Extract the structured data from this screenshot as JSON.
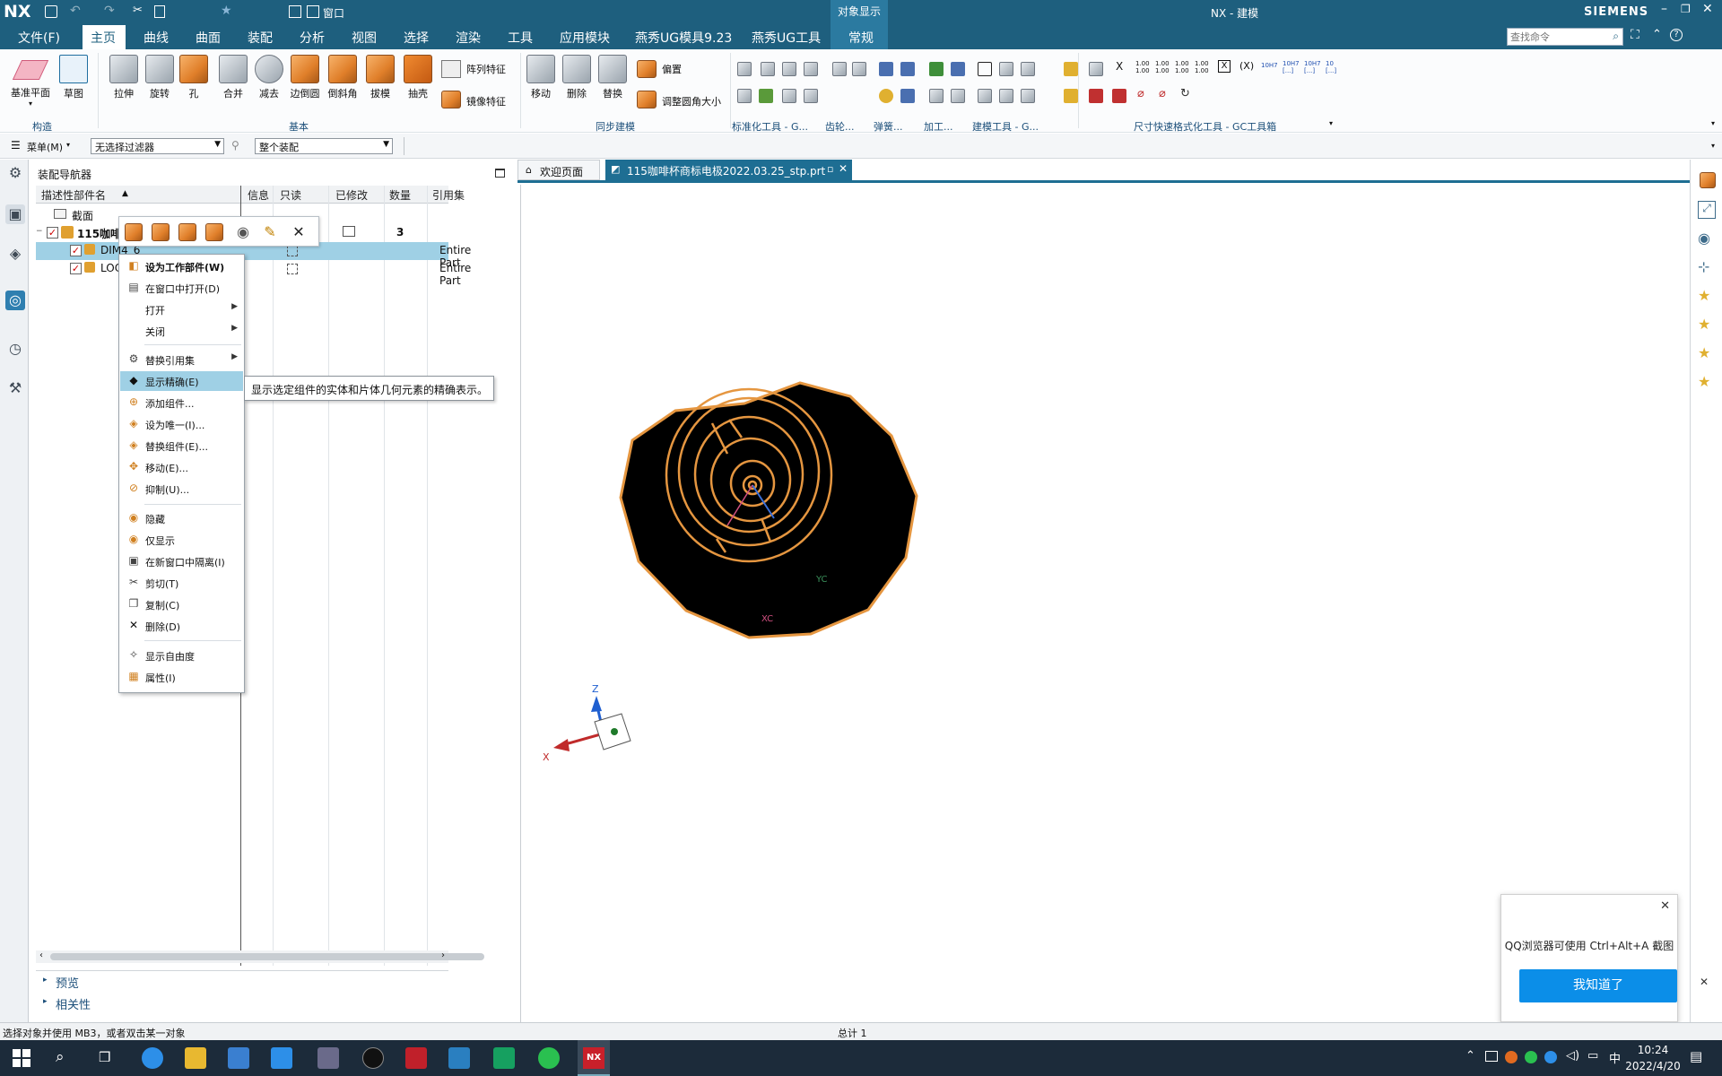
{
  "titlebar": {
    "app_logo": "NX",
    "context_label": "对象显示",
    "title": "NX - 建模",
    "brand": "SIEMENS",
    "quick_access_window": "窗口"
  },
  "menubar": {
    "items": [
      "文件(F)",
      "主页",
      "曲线",
      "曲面",
      "装配",
      "分析",
      "视图",
      "选择",
      "渲染",
      "工具",
      "应用模块",
      "燕秀UG模具9.23",
      "燕秀UG工具",
      "常规"
    ],
    "active": "主页",
    "search_placeholder": "查找命令"
  },
  "ribbon": {
    "construct": [
      "基准平面",
      "草图"
    ],
    "basic": [
      "拉伸",
      "旋转",
      "孔",
      "合并",
      "减去",
      "边倒圆",
      "倒斜角",
      "拔模",
      "抽壳"
    ],
    "basic_side": [
      "阵列特征",
      "镜像特征"
    ],
    "sync": [
      "移动",
      "删除",
      "替换"
    ],
    "sync_side": [
      "偏置",
      "调整圆角大小"
    ],
    "groups": [
      "构造",
      "基本",
      "同步建模",
      "标准化工具 - G...",
      "齿轮...",
      "弹簧...",
      "加工...",
      "建模工具 - G...",
      "尺寸快速格式化工具 - GC工具箱"
    ]
  },
  "filterbar": {
    "menu": "菜单(M)",
    "filter": "无选择过滤器",
    "scope": "整个装配"
  },
  "navigator": {
    "title": "装配导航器",
    "columns": [
      "描述性部件名",
      "信息",
      "只读",
      "已修改",
      "数量",
      "引用集"
    ],
    "rows": [
      {
        "name": "截面",
        "info": "",
        "qty": "",
        "refset": ""
      },
      {
        "name": "115咖啡",
        "info": "",
        "qty": "3",
        "refset": ""
      },
      {
        "name": "DIM4_6",
        "info": "",
        "qty": "",
        "refset": "Entire Part"
      },
      {
        "name": "LOC",
        "info": "",
        "qty": "",
        "refset": "Entire Part"
      }
    ],
    "sections": [
      "预览",
      "相关性"
    ]
  },
  "context_menu": {
    "items": [
      {
        "label": "设为工作部件(W)",
        "icon": "work-part"
      },
      {
        "label": "在窗口中打开(D)",
        "icon": "open-window"
      },
      {
        "label": "打开",
        "submenu": true
      },
      {
        "label": "关闭",
        "submenu": true
      },
      {
        "label": "替换引用集",
        "submenu": true,
        "icon": "refset"
      },
      {
        "label": "显示精确(E)",
        "icon": "diamond",
        "highlighted": true
      },
      {
        "label": "添加组件...",
        "icon": "add"
      },
      {
        "label": "设为唯一(I)...",
        "icon": "unique"
      },
      {
        "label": "替换组件(E)...",
        "icon": "replace"
      },
      {
        "label": "移动(E)...",
        "icon": "move"
      },
      {
        "label": "抑制(U)...",
        "icon": "suppress"
      },
      {
        "label": "隐藏",
        "icon": "hide"
      },
      {
        "label": "仅显示",
        "icon": "show-only"
      },
      {
        "label": "在新窗口中隔离(I)",
        "icon": "isolate"
      },
      {
        "label": "剪切(T)",
        "icon": "cut"
      },
      {
        "label": "复制(C)",
        "icon": "copy"
      },
      {
        "label": "删除(D)",
        "icon": "delete"
      },
      {
        "label": "显示自由度",
        "icon": "dof"
      },
      {
        "label": "属性(I)",
        "icon": "properties"
      }
    ],
    "tooltip": "显示选定组件的实体和片体几何元素的精确表示。"
  },
  "tabs": [
    "欢迎页面",
    "115咖啡杯商标电极2022.03.25_stp.prt"
  ],
  "viewport": {
    "triad": {
      "z": "Z",
      "x": "X"
    },
    "wcs": {
      "xc": "XC",
      "yc": "YC"
    }
  },
  "qq_popup": {
    "message": "QQ浏览器可使用 Ctrl+Alt+A 截图",
    "button": "我知道了"
  },
  "status": {
    "left": "选择对象并使用 MB3，或者双击某一对象",
    "center": "总计 1"
  },
  "taskbar": {
    "ime": "中",
    "time": "10:24",
    "date": "2022/4/20",
    "app_label": "NX"
  }
}
